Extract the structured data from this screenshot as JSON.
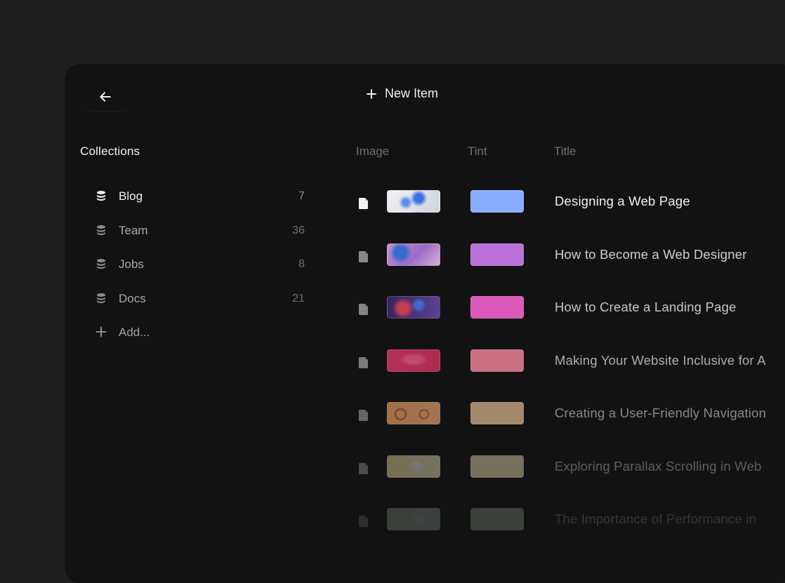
{
  "header": {
    "new_item_label": "New Item"
  },
  "sidebar": {
    "title": "Collections",
    "items": [
      {
        "label": "Blog",
        "count": "7"
      },
      {
        "label": "Team",
        "count": "36"
      },
      {
        "label": "Jobs",
        "count": "8"
      },
      {
        "label": "Docs",
        "count": "21"
      }
    ],
    "add_label": "Add..."
  },
  "table": {
    "columns": [
      "Image",
      "Tint",
      "Title"
    ],
    "rows": [
      {
        "title": "Designing a Web Page",
        "tint": "#8aacff",
        "thumb": "blue-splash"
      },
      {
        "title": "How to Become a Web Designer",
        "tint": "#d27ff5",
        "thumb": "purple-abstract"
      },
      {
        "title": "How to Create a Landing Page",
        "tint": "#ff66d6",
        "thumb": "blue-red-3d"
      },
      {
        "title": "Making Your Website Inclusive for A",
        "tint": "#ff8ca4",
        "thumb": "pink-shape"
      },
      {
        "title": "Creating a User-Friendly Navigation",
        "tint": "#ffd3a4",
        "thumb": "orange-swirl"
      },
      {
        "title": "Exploring Parallax Scrolling in Web",
        "tint": "#fff4c4",
        "thumb": "yellow-pale"
      },
      {
        "title": "The Importance of Performance in",
        "tint": "#e2fbe2",
        "thumb": "green-pale"
      }
    ]
  }
}
